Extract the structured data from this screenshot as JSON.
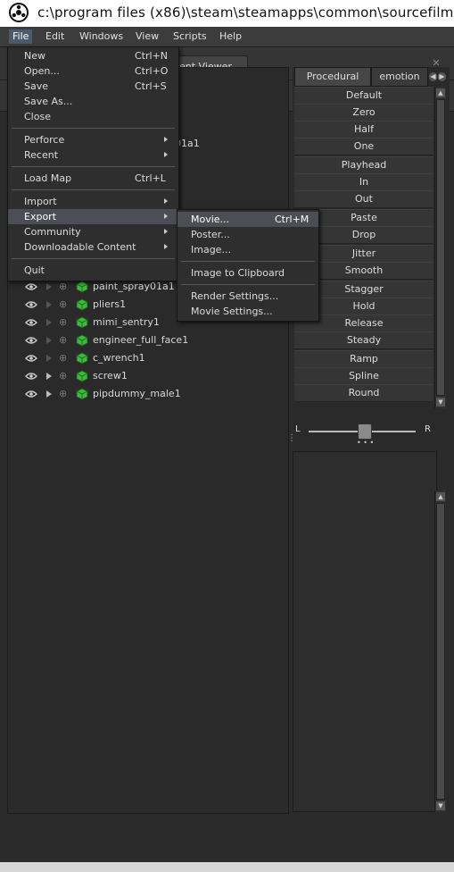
{
  "window": {
    "title": "c:\\program files (x86)\\steam\\steamapps\\common\\sourcefilm"
  },
  "menubar": {
    "items": [
      "File",
      "Edit",
      "Windows",
      "View",
      "Scripts",
      "Help"
    ],
    "active": "File"
  },
  "tabs": {
    "visible_tab_label": "ent Viewer"
  },
  "tree": {
    "partial_label": "01a1",
    "rows": [
      {
        "label": "paint_spray01a1",
        "expandable": false
      },
      {
        "label": "pliers1",
        "expandable": false
      },
      {
        "label": "mimi_sentry1",
        "expandable": false
      },
      {
        "label": "engineer_full_face1",
        "expandable": false
      },
      {
        "label": "c_wrench1",
        "expandable": false
      },
      {
        "label": "screw1",
        "expandable": true
      },
      {
        "label": "pipdummy_male1",
        "expandable": true
      }
    ]
  },
  "right_panel": {
    "tabs": [
      "Procedural",
      "emotion"
    ],
    "active_tab": "Procedural",
    "buttons": [
      "Default",
      "Zero",
      "Half",
      "One",
      "Playhead",
      "In",
      "Out",
      "Paste",
      "Drop",
      "Jitter",
      "Smooth",
      "Stagger",
      "Hold",
      "Release",
      "Steady",
      "Ramp",
      "Spline",
      "Round"
    ],
    "balance_slider": {
      "left_label": "L",
      "right_label": "R",
      "value": 0.5
    }
  },
  "file_menu": {
    "items": [
      {
        "label": "New",
        "shortcut": "Ctrl+N"
      },
      {
        "label": "Open...",
        "shortcut": "Ctrl+O"
      },
      {
        "label": "Save",
        "shortcut": "Ctrl+S"
      },
      {
        "label": "Save As...",
        "shortcut": ""
      },
      {
        "label": "Close",
        "shortcut": ""
      },
      {
        "label": "Perforce",
        "submenu": true
      },
      {
        "label": "Recent",
        "submenu": true
      },
      {
        "label": "Load Map",
        "shortcut": "Ctrl+L"
      },
      {
        "label": "Import",
        "submenu": true
      },
      {
        "label": "Export",
        "submenu": true,
        "highlighted": true
      },
      {
        "label": "Community",
        "submenu": true
      },
      {
        "label": "Downloadable Content",
        "submenu": true
      },
      {
        "label": "Quit",
        "shortcut": ""
      }
    ]
  },
  "export_menu": {
    "items": [
      {
        "label": "Movie...",
        "shortcut": "Ctrl+M",
        "highlighted": true
      },
      {
        "label": "Poster..."
      },
      {
        "label": "Image..."
      },
      {
        "label": "Image to Clipboard"
      },
      {
        "label": "Render Settings..."
      },
      {
        "label": "Movie Settings..."
      }
    ]
  },
  "colors": {
    "background": "#2b2b2b",
    "menu_highlight": "#4b4e55",
    "node_cube": "#3fb83f"
  }
}
